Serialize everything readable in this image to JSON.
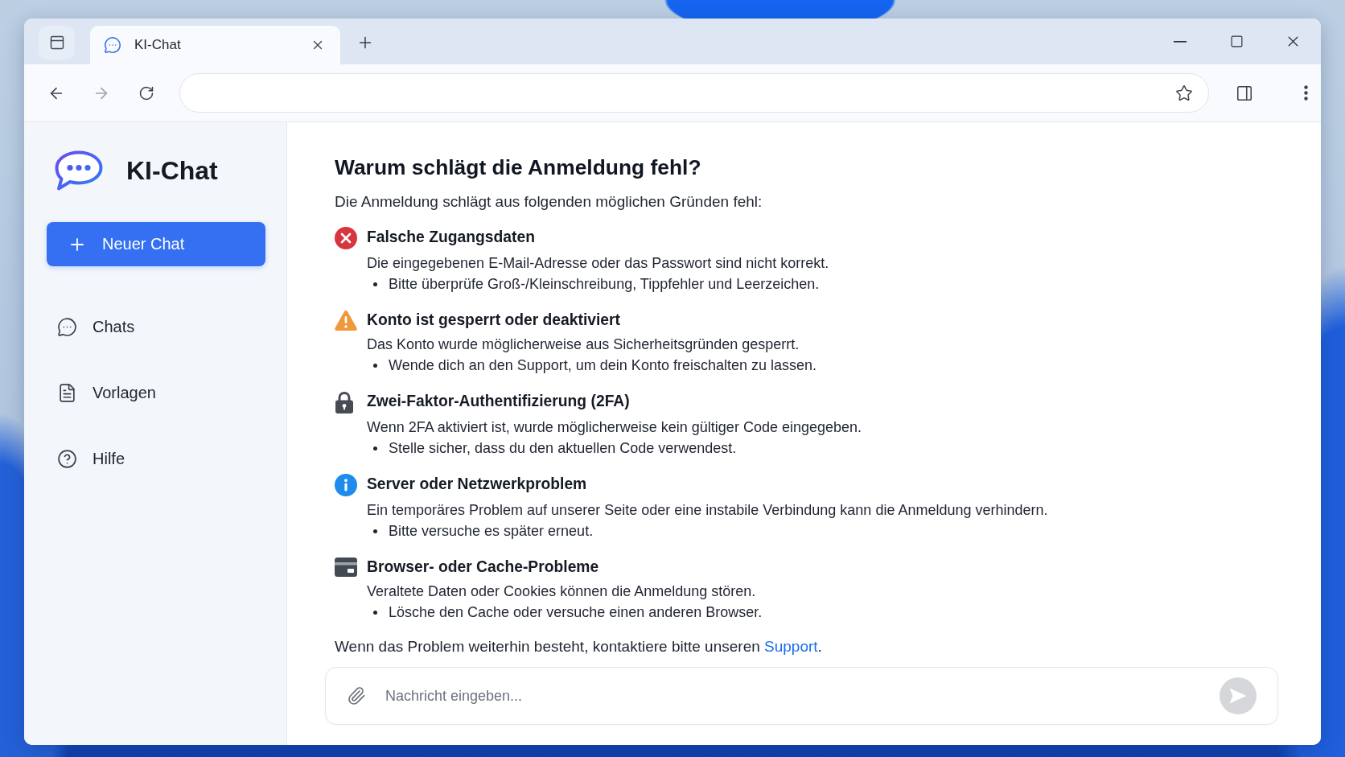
{
  "browser": {
    "tabs": [
      {
        "title": "KI-Chat",
        "selected": true
      }
    ],
    "forward_disabled": true
  },
  "sidebar": {
    "app_title": "KI-Chat",
    "new_chat": "Neuer Chat",
    "nav": [
      {
        "kind": "chats",
        "label": "Chats",
        "selected": false
      },
      {
        "kind": "templates",
        "label": "Vorlagen",
        "selected": false
      },
      {
        "kind": "help",
        "label": "Hilfe",
        "selected": false
      }
    ]
  },
  "article": {
    "heading": "Warum schlägt die Anmeldung fehl?",
    "intro": "Die Anmeldung schlägt aus folgenden möglichen Gründen fehl:",
    "reasons": [
      {
        "kind": "error",
        "title": "Falsche Zugangsdaten",
        "description": "Die eingegebenen E-Mail-Adresse oder das Passwort sind nicht korrekt.",
        "bullets": [
          "Bitte überprüfe Groß-/Kleinschreibung, Tippfehler und Leerzeichen."
        ]
      },
      {
        "kind": "warning",
        "title": "Konto ist gesperrt oder deaktiviert",
        "description": "Das Konto wurde möglicherweise aus Sicherheitsgründen gesperrt.",
        "bullets": [
          "Wende dich an den Support, um dein Konto freischalten zu lassen."
        ]
      },
      {
        "kind": "lock",
        "title": "Zwei-Faktor-Authentifizierung (2FA)",
        "description": "Wenn 2FA aktiviert ist, wurde möglicherweise kein gültiger Code eingegeben.",
        "bullets": [
          "Stelle sicher, dass du den aktuellen Code verwendest."
        ]
      },
      {
        "kind": "info",
        "title": "Server oder Netzwerkproblem",
        "description": "Ein temporäres Problem auf unserer Seite oder eine instabile Verbindung kann die Anmeldung verhindern.",
        "bullets": [
          "Bitte versuche es später erneut."
        ]
      },
      {
        "kind": "card",
        "title": "Browser- oder Cache-Probleme",
        "description": "Veraltete Daten oder Cookies können die Anmeldung stören.",
        "bullets": [
          "Lösche den Cache oder versuche einen anderen Browser."
        ]
      }
    ],
    "footer": {
      "text": "Wenn das Problem weiterhin besteht, kontaktiere bitte unseren",
      "link": "Support",
      "end": "."
    }
  },
  "composer": {
    "placeholder": "Nachricht eingeben...",
    "send_disabled": true
  }
}
